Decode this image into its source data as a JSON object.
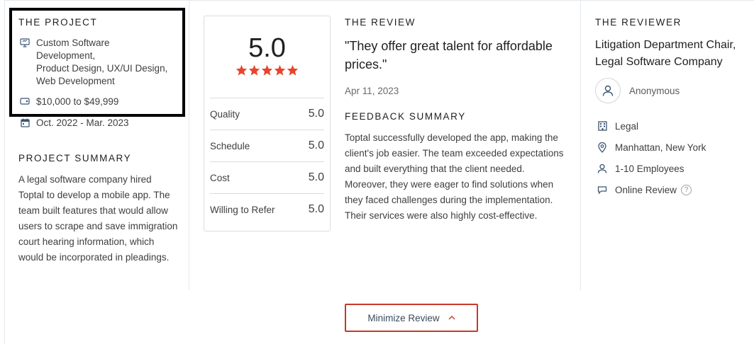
{
  "project": {
    "heading": "THE PROJECT",
    "services_line1": "Custom Software",
    "services_line2": "Development,",
    "services_line3": "Product Design, UX/UI Design,",
    "services_line4": "Web Development",
    "budget": "$10,000 to $49,999",
    "dates": "Oct. 2022 - Mar. 2023",
    "icons": {
      "services": "monitor-icon",
      "budget": "tag-icon",
      "dates": "calendar-icon"
    }
  },
  "summary": {
    "heading": "PROJECT SUMMARY",
    "text": "A legal software company hired Toptal to develop a mobile app. The team built features that would allow users to scrape and save immigration court hearing information, which would be incorporated in pleadings."
  },
  "scores": {
    "overall": "5.0",
    "stars": 5,
    "rows": [
      {
        "label": "Quality",
        "value": "5.0"
      },
      {
        "label": "Schedule",
        "value": "5.0"
      },
      {
        "label": "Cost",
        "value": "5.0"
      },
      {
        "label": "Willing to Refer",
        "value": "5.0"
      }
    ]
  },
  "review": {
    "heading": "THE REVIEW",
    "quote": "\"They offer great talent for affordable prices.\"",
    "date": "Apr 11, 2023",
    "feedback_heading": "FEEDBACK SUMMARY",
    "feedback": "Toptal successfully developed the app, making the client's job easier.  The team exceeded expectations and built everything that the client needed. Moreover, they were eager to find solutions when they faced challenges during the implementation. Their services were also highly cost-effective."
  },
  "reviewer": {
    "heading": "THE REVIEWER",
    "title": "Litigation Department Chair, Legal Software Company",
    "name": "Anonymous",
    "industry": "Legal",
    "location": "Manhattan, New York",
    "size": "1-10 Employees",
    "review_type": "Online Review",
    "help_glyph": "?"
  },
  "actions": {
    "minimize_label": "Minimize Review"
  },
  "colors": {
    "accent": "#c8382a",
    "star": "#e8442d",
    "divider": "#e3e8ec",
    "icon": "#3b5470"
  }
}
